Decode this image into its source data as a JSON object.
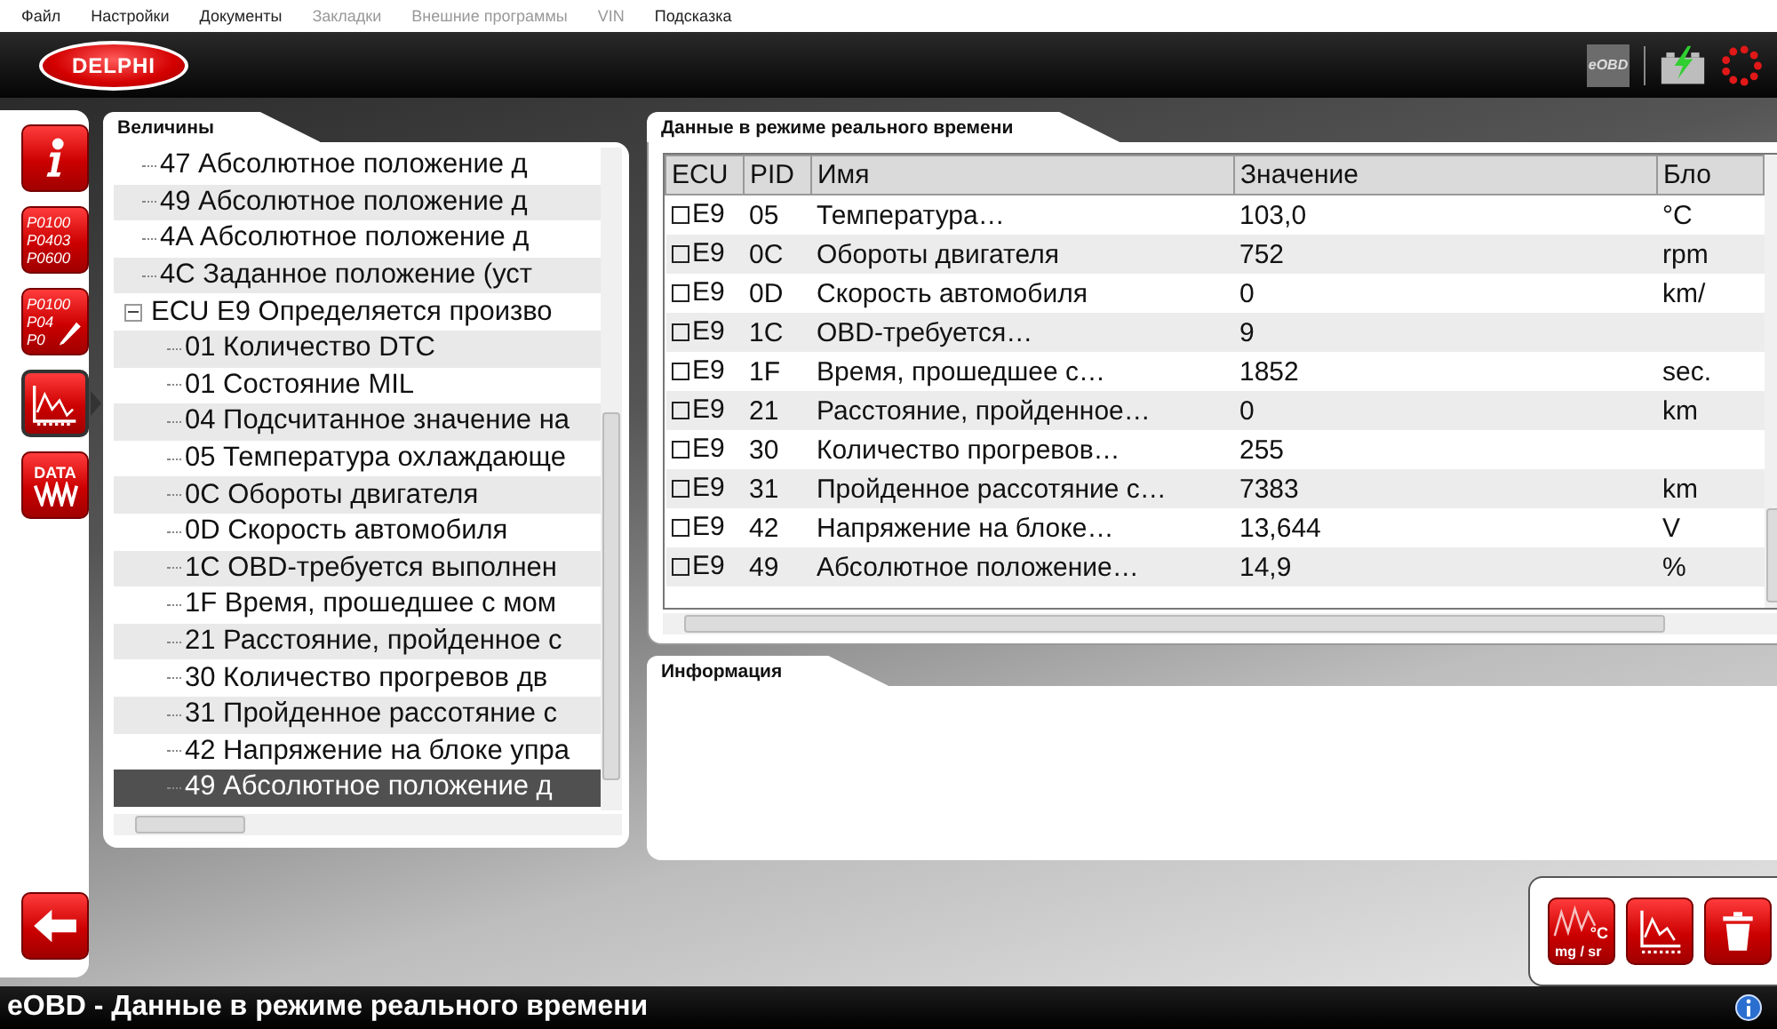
{
  "menu": [
    {
      "label": "Файл",
      "disabled": false
    },
    {
      "label": "Настройки",
      "disabled": false
    },
    {
      "label": "Документы",
      "disabled": false
    },
    {
      "label": "Закладки",
      "disabled": true
    },
    {
      "label": "Внешние программы",
      "disabled": true
    },
    {
      "label": "VIN",
      "disabled": true
    },
    {
      "label": "Подсказка",
      "disabled": false
    }
  ],
  "header": {
    "logo": "DELPHI",
    "mode_badge": "eOBD"
  },
  "sidebar": {
    "items": [
      {
        "kind": "info",
        "selected": false
      },
      {
        "kind": "codes",
        "lines": [
          "P0100",
          "P0403",
          "P0600"
        ],
        "selected": false
      },
      {
        "kind": "codes-edit",
        "lines": [
          "P0100",
          "P04",
          "P0"
        ],
        "selected": false
      },
      {
        "kind": "graph",
        "selected": true
      },
      {
        "kind": "data",
        "lines": [
          "DATA"
        ],
        "selected": false
      }
    ]
  },
  "tree_panel": {
    "title": "Величины",
    "tree": [
      {
        "label": "47 Абсолютное положение д",
        "selected": false
      },
      {
        "label": "49 Абсолютное положение д",
        "selected": false
      },
      {
        "label": "4A Абсолютное положение д",
        "selected": false
      },
      {
        "label": "4C Заданное положение (уст",
        "selected": false
      },
      {
        "label": "ECU E9 Определяется произво",
        "expanded": true,
        "selected": false,
        "children": [
          {
            "label": "01 Количество DTC",
            "selected": false
          },
          {
            "label": "01 Состояние MIL",
            "selected": false
          },
          {
            "label": "04 Подсчитанное значение на",
            "selected": false
          },
          {
            "label": "05 Температура охлаждающе",
            "selected": false
          },
          {
            "label": "0C Обороты двигателя",
            "selected": false
          },
          {
            "label": "0D Скорость автомобиля",
            "selected": false
          },
          {
            "label": "1C OBD-требуется выполнен",
            "selected": false
          },
          {
            "label": "1F Время, прошедшее с мом",
            "selected": false
          },
          {
            "label": "21 Расстояние, пройденное с",
            "selected": false
          },
          {
            "label": "30 Количество прогревов дв",
            "selected": false
          },
          {
            "label": "31 Пройденное рассотяние с",
            "selected": false
          },
          {
            "label": "42 Напряжение на блоке упра",
            "selected": false
          },
          {
            "label": "49 Абсолютное положение д",
            "selected": true
          }
        ]
      }
    ]
  },
  "data_panel": {
    "title": "Данные в режиме реального времени",
    "columns": [
      "ECU",
      "PID",
      "Имя",
      "Значение",
      "Бло"
    ],
    "rows": [
      {
        "checked": false,
        "ecu": "E9",
        "pid": "05",
        "name": "Температура…",
        "value": "103,0",
        "unit": "°C"
      },
      {
        "checked": false,
        "ecu": "E9",
        "pid": "0C",
        "name": "Обороты двигателя",
        "value": "752",
        "unit": "rpm"
      },
      {
        "checked": false,
        "ecu": "E9",
        "pid": "0D",
        "name": "Скорость автомобиля",
        "value": "0",
        "unit": "km/"
      },
      {
        "checked": false,
        "ecu": "E9",
        "pid": "1C",
        "name": "OBD-требуется…",
        "value": "9",
        "unit": ""
      },
      {
        "checked": false,
        "ecu": "E9",
        "pid": "1F",
        "name": "Время, прошедшее с…",
        "value": "1852",
        "unit": "sec."
      },
      {
        "checked": false,
        "ecu": "E9",
        "pid": "21",
        "name": "Расстояние, пройденное…",
        "value": "0",
        "unit": "km"
      },
      {
        "checked": false,
        "ecu": "E9",
        "pid": "30",
        "name": "Количество прогревов…",
        "value": "255",
        "unit": ""
      },
      {
        "checked": false,
        "ecu": "E9",
        "pid": "31",
        "name": "Пройденное рассотяние с…",
        "value": "7383",
        "unit": "km"
      },
      {
        "checked": false,
        "ecu": "E9",
        "pid": "42",
        "name": "Напряжение на блоке…",
        "value": "13,644",
        "unit": "V"
      },
      {
        "checked": false,
        "ecu": "E9",
        "pid": "49",
        "name": "Абсолютное положение…",
        "value": "14,9",
        "unit": "%"
      }
    ]
  },
  "info_panel": {
    "title": "Информация"
  },
  "actions": [
    {
      "kind": "units",
      "glyphs": [
        "°C",
        "mg / sr"
      ]
    },
    {
      "kind": "chart"
    },
    {
      "kind": "delete"
    }
  ],
  "status_bar": {
    "title": "eOBD - Данные в режиме реального времени"
  }
}
